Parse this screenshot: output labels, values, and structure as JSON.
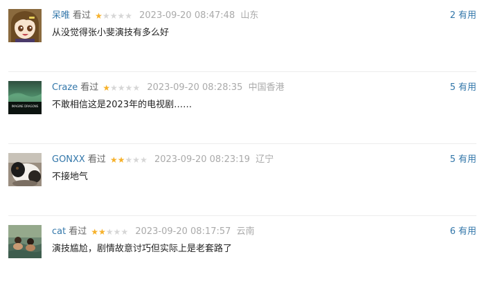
{
  "comments": [
    {
      "username": "呆唯",
      "status": "看过",
      "rating": 1,
      "rating_max": 5,
      "time": "2023-09-20 08:47:48",
      "location": "山东",
      "content": "从没觉得张小斐演技有多么好",
      "votes": "2",
      "vote_label": "有用",
      "avatar": "anime-girl-avatar"
    },
    {
      "username": "Craze",
      "status": "看过",
      "rating": 1,
      "rating_max": 5,
      "time": "2023-09-20 08:28:35",
      "location": "中国香港",
      "content": "不敢相信这是2023年的电视剧……",
      "votes": "5",
      "vote_label": "有用",
      "avatar": "album-cover-avatar",
      "avatar_text": "IMAGINE DRAGONS"
    },
    {
      "username": "GONXX",
      "status": "看过",
      "rating": 2,
      "rating_max": 5,
      "time": "2023-09-20 08:23:19",
      "location": "辽宁",
      "content": "不接地气",
      "votes": "5",
      "vote_label": "有用",
      "avatar": "guinea-pig-avatar"
    },
    {
      "username": "cat",
      "status": "看过",
      "rating": 2,
      "rating_max": 5,
      "time": "2023-09-20 08:17:57",
      "location": "云南",
      "content": "演技尴尬，剧情故意讨巧但实际上是老套路了",
      "votes": "6",
      "vote_label": "有用",
      "avatar": "swimming-kids-avatar"
    }
  ],
  "colors": {
    "link": "#3377aa",
    "star_on": "#f6b12a",
    "star_off": "#d6d6d6",
    "meta": "#aaaaaa"
  }
}
